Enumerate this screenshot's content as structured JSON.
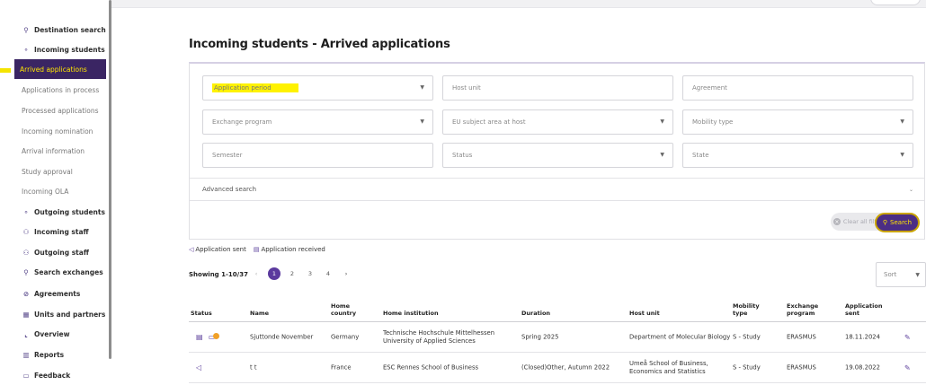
{
  "sidebar": {
    "items": [
      {
        "label": "Destination search",
        "icon": "search-icon",
        "glyph": "⚲",
        "bold": true
      },
      {
        "label": "Incoming students",
        "icon": "student-icon",
        "glyph": "⚬",
        "bold": true
      },
      {
        "label": "Arrived applications",
        "icon": "",
        "glyph": "",
        "bold": false,
        "active": true
      },
      {
        "label": "Applications in process",
        "icon": "",
        "glyph": "",
        "bold": false
      },
      {
        "label": "Processed applications",
        "icon": "",
        "glyph": "",
        "bold": false
      },
      {
        "label": "Incoming nomination",
        "icon": "",
        "glyph": "",
        "bold": false
      },
      {
        "label": "Arrival information",
        "icon": "",
        "glyph": "",
        "bold": false
      },
      {
        "label": "Study approval",
        "icon": "",
        "glyph": "",
        "bold": false
      },
      {
        "label": "Incoming OLA",
        "icon": "",
        "glyph": "",
        "bold": false
      },
      {
        "label": "Outgoing students",
        "icon": "student-icon",
        "glyph": "⚬",
        "bold": true
      },
      {
        "label": "Incoming staff",
        "icon": "staff-icon",
        "glyph": "⚇",
        "bold": true
      },
      {
        "label": "Outgoing staff",
        "icon": "staff-icon",
        "glyph": "⚇",
        "bold": true
      },
      {
        "label": "Search exchanges",
        "icon": "search-icon",
        "glyph": "⚲",
        "bold": true
      },
      {
        "label": "Agreements",
        "icon": "check-circle-icon",
        "glyph": "⊘",
        "bold": true
      },
      {
        "label": "Units and partners",
        "icon": "building-icon",
        "glyph": "▦",
        "bold": true
      },
      {
        "label": "Overview",
        "icon": "chart-icon",
        "glyph": "⌞",
        "bold": true
      },
      {
        "label": "Reports",
        "icon": "bar-chart-icon",
        "glyph": "▥",
        "bold": true
      },
      {
        "label": "Feedback",
        "icon": "feedback-icon",
        "glyph": "▭",
        "bold": true
      }
    ]
  },
  "page": {
    "title": "Incoming students - Arrived applications"
  },
  "filters": {
    "application_period": "Application period",
    "host_unit": "Host unit",
    "agreement": "Agreement",
    "exchange_program": "Exchange program",
    "eu_subject_area": "EU subject area at host",
    "mobility_type": "Mobility type",
    "semester": "Semester",
    "status": "Status",
    "state": "State",
    "advanced_search": "Advanced search",
    "clear_all": "Clear all filters",
    "search": "Search"
  },
  "legend": {
    "sent": "Application sent",
    "received": "Application received"
  },
  "pagination": {
    "showing": "Showing 1-10/37",
    "pages": [
      "1",
      "2",
      "3",
      "4"
    ],
    "current": "1"
  },
  "sort": {
    "placeholder": "Sort"
  },
  "table": {
    "headers": {
      "status": "Status",
      "name": "Name",
      "home_country_1": "Home",
      "home_country_2": "country",
      "home_institution": "Home institution",
      "duration": "Duration",
      "host_unit": "Host unit",
      "mobility_1": "Mobility",
      "mobility_2": "type",
      "exchange_1": "Exchange",
      "exchange_2": "program",
      "application_1": "Application",
      "application_2": "sent"
    },
    "rows": [
      {
        "name": "Sjuttonde November",
        "country": "Germany",
        "inst_1": "Technische Hochschule Mittelhessen",
        "inst_2": "University of Applied Sciences",
        "duration": "Spring 2025",
        "host_1": "Department of Molecular Biology",
        "host_2": "",
        "mobility": "S - Study",
        "program": "ERASMUS",
        "sent": "18.11.2024"
      },
      {
        "name": "t t",
        "country": "France",
        "inst_1": "ESC Rennes School of Business",
        "inst_2": "",
        "duration": "(Closed)Other, Autumn 2022",
        "host_1": "Umeå School of Business,",
        "host_2": "Economics and Statistics",
        "mobility": "S - Study",
        "program": "ERASMUS",
        "sent": "19.08.2022"
      }
    ]
  },
  "colors": {
    "accent": "#4b2d85",
    "highlight": "#fff200",
    "active_bg": "#3a2563"
  }
}
